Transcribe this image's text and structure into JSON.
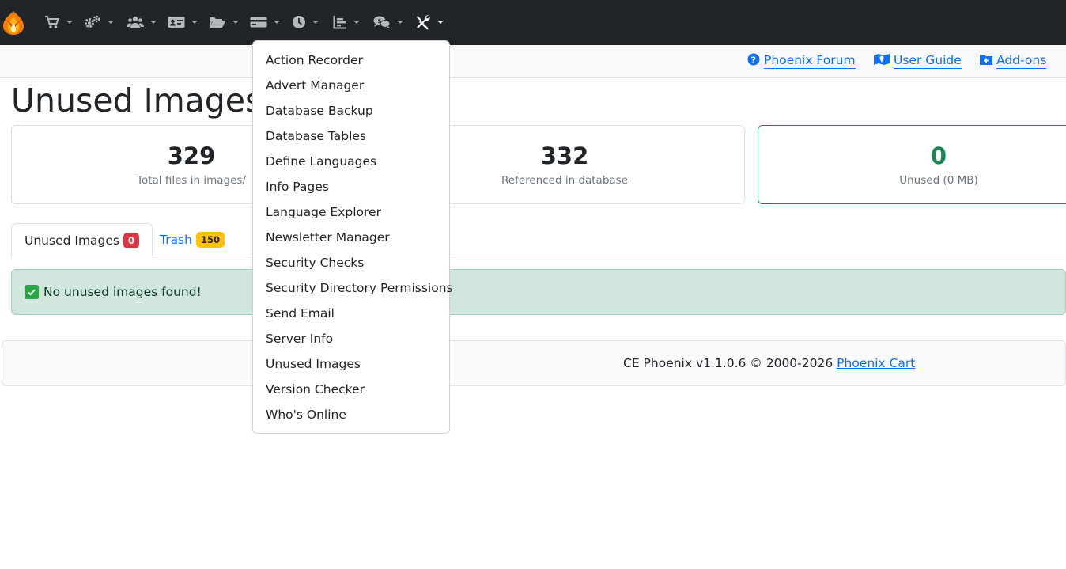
{
  "navbar": {
    "items": [
      {
        "icon": "cart-icon"
      },
      {
        "icon": "gears-icon"
      },
      {
        "icon": "users-icon"
      },
      {
        "icon": "id-card-icon"
      },
      {
        "icon": "folder-open-icon"
      },
      {
        "icon": "credit-card-icon"
      },
      {
        "icon": "clock-icon"
      },
      {
        "icon": "chart-bar-icon"
      },
      {
        "icon": "comments-dollar-icon"
      },
      {
        "icon": "tools-icon"
      }
    ],
    "bg_color": "#212529"
  },
  "subbar": {
    "links": [
      {
        "label": "Phoenix Forum",
        "icon": "question-circle-icon"
      },
      {
        "label": "User Guide",
        "icon": "map-icon"
      },
      {
        "label": "Add-ons",
        "icon": "folder-plus-icon"
      }
    ]
  },
  "page": {
    "title": "Unused Images"
  },
  "cards": [
    {
      "value": "329",
      "label": "Total files in images/"
    },
    {
      "value": "332",
      "label": "Referenced in database"
    },
    {
      "value": "0",
      "label": "Unused (0 MB)"
    }
  ],
  "tabs": [
    {
      "label": "Unused Images",
      "badge": "0"
    },
    {
      "label": "Trash",
      "badge": "150"
    }
  ],
  "alert": {
    "text": "No unused images found!"
  },
  "footer": {
    "text": "CE Phoenix v1.1.0.6 © 2000-2026 ",
    "link": "Phoenix Cart"
  },
  "dropdown": {
    "items": [
      "Action Recorder",
      "Advert Manager",
      "Database Backup",
      "Database Tables",
      "Define Languages",
      "Info Pages",
      "Language Explorer",
      "Newsletter Manager",
      "Security Checks",
      "Security Directory Permissions",
      "Send Email",
      "Server Info",
      "Unused Images",
      "Version Checker",
      "Who's Online"
    ]
  },
  "colors": {
    "primary": "#0d6efd",
    "success": "#198754",
    "danger": "#dc3545",
    "warning": "#ffc107",
    "alert_bg": "#d1e7dd"
  }
}
